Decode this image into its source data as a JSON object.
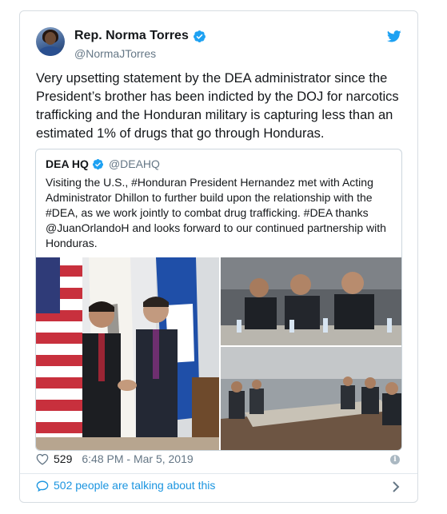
{
  "author": {
    "name": "Rep. Norma Torres",
    "handle": "@NormaJTorres",
    "avatar_icon": "avatar"
  },
  "tweet": {
    "text": "Very upsetting statement by the DEA administrator since the President’s brother has been indicted by the DOJ for narcotics trafficking and the Honduran military is capturing less than an estimated 1% of drugs that go through Honduras."
  },
  "quoted": {
    "name": "DEA HQ",
    "handle": "@DEAHQ",
    "text": "Visiting the U.S., #Honduran President Hernandez met with Acting Administrator Dhillon to further build upon the relationship with the #DEA, as we work jointly to combat drug trafficking.  #DEA thanks @JuanOrlandoH and looks forward to our continued partnership with Honduras.",
    "photos": [
      "handshake-flags-photo",
      "meeting-table-closeup-photo",
      "conference-room-photo"
    ]
  },
  "meta": {
    "likes": "529",
    "timestamp": "6:48 PM - Mar 5, 2019",
    "info_glyph": "i"
  },
  "conversation": {
    "label": "502 people are talking about this"
  },
  "colors": {
    "twitter_blue": "#1da1f2",
    "link_blue": "#1b95e0",
    "muted": "#657786",
    "border": "#d7dde2"
  }
}
